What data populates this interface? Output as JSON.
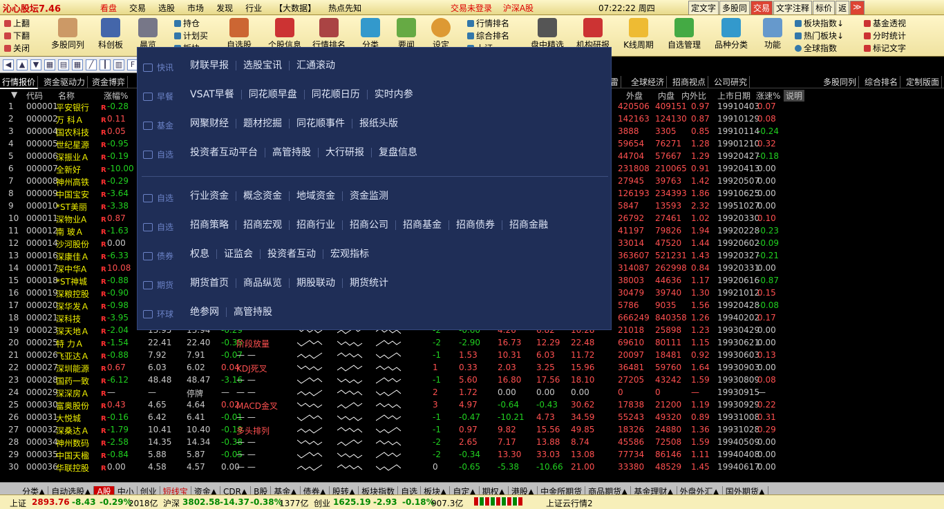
{
  "title": "沁心股坛7.46",
  "menu": [
    "看盘",
    "交易",
    "选股",
    "市场",
    "发现",
    "行业",
    "【大数据】",
    "热点先知"
  ],
  "status_login": "交易未登录",
  "status_market": "沪深A股",
  "clock": "07:22:22 周四",
  "title_buttons": [
    "定文字",
    "多股同",
    "交易",
    "文字注释",
    "标价",
    "返",
    "≫"
  ],
  "toolbar": {
    "page_nav": [
      "上翻",
      "下翻",
      "关闭"
    ],
    "big_icons": [
      "多股同列",
      "科创板",
      "晨览",
      "",
      "自选股",
      "个股信息",
      "行情排名",
      "分类",
      "要闻",
      "设定",
      "",
      "盘中精选",
      "机构研报",
      "K线周期",
      "自选管理",
      "品种分类",
      "功能"
    ],
    "smalls1": [
      "持仓",
      "计划买",
      "板块"
    ],
    "smalls2": [
      "行情排名",
      "综合排名",
      "上证"
    ],
    "smalls3": [
      "板块指数↓",
      "热门板块↓",
      "全球指数"
    ],
    "smalls4": [
      "基金透视",
      "分时统计",
      "标记文字"
    ]
  },
  "tabs_left": [
    "行情报价",
    "资金驱动力",
    "资金博弈"
  ],
  "tabs_mid": [
    "雷",
    "全球经济",
    "招商视点",
    "公司研究"
  ],
  "tabs_right": [
    "多股同列",
    "综合排名",
    "定制版面"
  ],
  "columns": {
    "code": "代码",
    "name": "名称",
    "change": "涨幅%",
    "outside": "外盘",
    "inside": "内盘",
    "ratio": "内外比",
    "listing": "上市日期",
    "speed": "涨速%",
    "note": "说明"
  },
  "rows": [
    {
      "no": "1",
      "code": "000001",
      "name": "平安银行",
      "chg": "-0.28",
      "out": "420506",
      "in": "409151",
      "ratio": "0.97",
      "date": "19910403",
      "spd": "0.07"
    },
    {
      "no": "2",
      "code": "000002",
      "name": "万  科Ａ",
      "chg": "0.11",
      "out": "142163",
      "in": "124130",
      "ratio": "0.87",
      "date": "19910129",
      "spd": "0.08"
    },
    {
      "no": "3",
      "code": "000004",
      "name": "国农科技",
      "chg": "0.05",
      "out": "3888",
      "in": "3305",
      "ratio": "0.85",
      "date": "19910114",
      "spd": "-0.24"
    },
    {
      "no": "4",
      "code": "000005",
      "name": "世纪星源",
      "chg": "-0.95",
      "out": "59654",
      "in": "76271",
      "ratio": "1.28",
      "date": "19901210",
      "spd": "0.32"
    },
    {
      "no": "5",
      "code": "000006",
      "name": "深振业Ａ",
      "chg": "-0.19",
      "out": "44704",
      "in": "57667",
      "ratio": "1.29",
      "date": "19920427",
      "spd": "-0.18"
    },
    {
      "no": "6",
      "code": "000007",
      "name": "全新好",
      "chg": "-10.00",
      "out": "231808",
      "in": "210065",
      "ratio": "0.91",
      "date": "19920413",
      "spd": "0.00"
    },
    {
      "no": "7",
      "code": "000008",
      "name": "神州高铁",
      "chg": "-0.29",
      "out": "27945",
      "in": "39763",
      "ratio": "1.42",
      "date": "19920507",
      "spd": "0.00"
    },
    {
      "no": "8",
      "code": "000009",
      "name": "中国宝安",
      "chg": "-3.64",
      "out": "126193",
      "in": "234393",
      "ratio": "1.86",
      "date": "19910625",
      "spd": "0.00"
    },
    {
      "no": "9",
      "code": "000010",
      "name": "*ST美丽",
      "chg": "-3.38",
      "out": "5847",
      "in": "13593",
      "ratio": "2.32",
      "date": "19951027",
      "spd": "0.00"
    },
    {
      "no": "10",
      "code": "000011",
      "name": "深物业A",
      "chg": "0.87",
      "out": "26792",
      "in": "27461",
      "ratio": "1.02",
      "date": "19920330",
      "spd": "0.10"
    },
    {
      "no": "11",
      "code": "000012",
      "name": "南  玻Ａ",
      "chg": "-1.63",
      "out": "41197",
      "in": "79826",
      "ratio": "1.94",
      "date": "19920228",
      "spd": "-0.23"
    },
    {
      "no": "12",
      "code": "000014",
      "name": "沙河股份",
      "chg": "0.00",
      "out": "33014",
      "in": "47520",
      "ratio": "1.44",
      "date": "19920602",
      "spd": "-0.09"
    },
    {
      "no": "13",
      "code": "000016",
      "name": "深康佳Ａ",
      "chg": "-6.33",
      "out": "363607",
      "in": "521231",
      "ratio": "1.43",
      "date": "19920327",
      "spd": "-0.21"
    },
    {
      "no": "14",
      "code": "000017",
      "name": "深中华A",
      "chg": "10.08",
      "out": "314087",
      "in": "262998",
      "ratio": "0.84",
      "date": "19920331",
      "spd": "0.00"
    },
    {
      "no": "15",
      "code": "000018",
      "name": "*ST神城",
      "chg": "-0.88",
      "out": "38003",
      "in": "44636",
      "ratio": "1.17",
      "date": "19920616",
      "spd": "-0.87"
    },
    {
      "no": "16",
      "code": "000019",
      "name": "深粮控股",
      "chg": "-0.90",
      "out": "30479",
      "in": "39740",
      "ratio": "1.30",
      "date": "19921012",
      "spd": "0.15"
    },
    {
      "no": "17",
      "code": "000020",
      "name": "深华发Ａ",
      "chg": "-0.98",
      "out": "5786",
      "in": "9035",
      "ratio": "1.56",
      "date": "19920428",
      "spd": "-0.08"
    },
    {
      "no": "18",
      "code": "000021",
      "name": "深科技",
      "chg": "-3.95",
      "out": "666249",
      "in": "840358",
      "ratio": "1.26",
      "date": "19940202",
      "spd": "0.17"
    },
    {
      "no": "19",
      "code": "000023",
      "name": "深天地Ａ",
      "chg": "-2.04",
      "p1": "13.95",
      "p2": "13.94",
      "p3": "-0.29",
      "desc": "",
      "c1": "-2",
      "c2": "-0.60",
      "c3": "4.26",
      "c4": "6.82",
      "c5": "10.28",
      "out": "21018",
      "in": "25898",
      "ratio": "1.23",
      "date": "19930429",
      "spd": "0.00"
    },
    {
      "no": "20",
      "code": "000025",
      "name": "特  力Ａ",
      "chg": "-1.54",
      "p1": "22.41",
      "p2": "22.40",
      "p3": "-0.35",
      "desc": "阶段放量",
      "c1": "-2",
      "c2": "-2.90",
      "c3": "16.73",
      "c4": "12.29",
      "c5": "22.48",
      "out": "69610",
      "in": "80111",
      "ratio": "1.15",
      "date": "19930621",
      "spd": "0.00"
    },
    {
      "no": "21",
      "code": "000026",
      "name": "飞亚达Ａ",
      "chg": "-0.88",
      "p1": "7.92",
      "p2": "7.91",
      "p3": "-0.07",
      "desc": "— —",
      "c1": "-1",
      "c2": "1.53",
      "c3": "10.31",
      "c4": "6.03",
      "c5": "11.72",
      "out": "20097",
      "in": "18481",
      "ratio": "0.92",
      "date": "19930603",
      "spd": "0.13"
    },
    {
      "no": "22",
      "code": "000027",
      "name": "深圳能源",
      "chg": "0.67",
      "p1": "6.03",
      "p2": "6.02",
      "p3": "0.04",
      "desc": "KDJ死叉",
      "c1": "1",
      "c2": "0.33",
      "c3": "2.03",
      "c4": "3.25",
      "c5": "15.96",
      "out": "36481",
      "in": "59760",
      "ratio": "1.64",
      "date": "19930903",
      "spd": "0.00"
    },
    {
      "no": "23",
      "code": "000028",
      "name": "国药一致",
      "chg": "-6.12",
      "p1": "48.48",
      "p2": "48.47",
      "p3": "-3.16",
      "desc": "— —",
      "c1": "-1",
      "c2": "5.60",
      "c3": "16.80",
      "c4": "17.56",
      "c5": "18.10",
      "out": "27205",
      "in": "43242",
      "ratio": "1.59",
      "date": "19930809",
      "spd": "0.08"
    },
    {
      "no": "24",
      "code": "000029",
      "name": "深深房Ａ",
      "chg": "—",
      "p1": "—",
      "p2": "停牌",
      "p3": "—",
      "desc": "— —",
      "c1": "2",
      "c2": "1.72",
      "c3": "0.00",
      "c4": "0.00",
      "c5": "0.00",
      "out": "0",
      "in": "0",
      "ratio": "—",
      "date": "19930915",
      "spd": "—"
    },
    {
      "no": "25",
      "code": "000030",
      "name": "富奥股份",
      "chg": "0.43",
      "p1": "4.65",
      "p2": "4.64",
      "p3": "0.02",
      "desc": "MACD金叉",
      "c1": "3",
      "c2": "4.97",
      "c3": "-0.64",
      "c4": "-0.43",
      "c5": "30.62",
      "out": "17838",
      "in": "21200",
      "ratio": "1.19",
      "date": "19930929",
      "spd": "0.22"
    },
    {
      "no": "26",
      "code": "000031",
      "name": "大悦城",
      "chg": "-0.16",
      "p1": "6.42",
      "p2": "6.41",
      "p3": "-0.01",
      "desc": "— —",
      "c1": "-1",
      "c2": "-0.47",
      "c3": "-10.21",
      "c4": "4.73",
      "c5": "34.59",
      "out": "55243",
      "in": "49320",
      "ratio": "0.89",
      "date": "19931008",
      "spd": "0.31"
    },
    {
      "no": "27",
      "code": "000032",
      "name": "深桑达Ａ",
      "chg": "-1.79",
      "p1": "10.41",
      "p2": "10.40",
      "p3": "-0.19",
      "desc": "多头排列",
      "c1": "-1",
      "c2": "0.97",
      "c3": "9.82",
      "c4": "15.56",
      "c5": "49.85",
      "out": "18326",
      "in": "24880",
      "ratio": "1.36",
      "date": "19931028",
      "spd": "0.29"
    },
    {
      "no": "28",
      "code": "000034",
      "name": "神州数码",
      "chg": "-2.58",
      "p1": "14.35",
      "p2": "14.34",
      "p3": "-0.38",
      "desc": "— —",
      "c1": "-2",
      "c2": "2.65",
      "c3": "7.17",
      "c4": "13.88",
      "c5": "8.74",
      "out": "45586",
      "in": "72508",
      "ratio": "1.59",
      "date": "19940509",
      "spd": "0.00"
    },
    {
      "no": "29",
      "code": "000035",
      "name": "中国天楹",
      "chg": "-0.84",
      "p1": "5.88",
      "p2": "5.87",
      "p3": "-0.05",
      "desc": "— —",
      "c1": "-2",
      "c2": "-0.34",
      "c3": "13.30",
      "c4": "33.03",
      "c5": "13.08",
      "out": "77734",
      "in": "86146",
      "ratio": "1.11",
      "date": "19940408",
      "spd": "0.00"
    },
    {
      "no": "30",
      "code": "000036",
      "name": "华联控股",
      "chg": "0.00",
      "p1": "4.58",
      "p2": "4.57",
      "p3": "0.00",
      "desc": "— —",
      "c1": "0",
      "c2": "-0.65",
      "c3": "-5.38",
      "c4": "-10.66",
      "c5": "21.00",
      "out": "33380",
      "in": "48529",
      "ratio": "1.45",
      "date": "19940617",
      "spd": "0.00"
    }
  ],
  "overlay": [
    {
      "cat": "快讯",
      "links": [
        "财联早报",
        "选股宝讯",
        "汇通滚动"
      ]
    },
    {
      "cat": "早餐",
      "links": [
        "VSAT早餐",
        "同花顺早盘",
        "同花顺日历",
        "实时内参"
      ]
    },
    {
      "cat": "基金",
      "links": [
        "网聚财经",
        "题材挖掘",
        "同花顺事件",
        "报纸头版"
      ]
    },
    {
      "cat": "自选",
      "links": [
        "投资者互动平台",
        "高管持股",
        "大行研报",
        "复盘信息"
      ]
    },
    {
      "cat": "自选",
      "links": [
        "行业资金",
        "概念资金",
        "地域资金",
        "资金监测"
      ]
    },
    {
      "cat": "自选",
      "links": [
        "招商策略",
        "招商宏观",
        "招商行业",
        "招商公司",
        "招商基金",
        "招商债券",
        "招商金融"
      ]
    },
    {
      "cat": "债券",
      "links": [
        "权息",
        "证监会",
        "投资者互动",
        "宏观指标"
      ]
    },
    {
      "cat": "期货",
      "links": [
        "期货首页",
        "商品纵览",
        "期股联动",
        "期货统计"
      ]
    },
    {
      "cat": "环球",
      "links": [
        "绝参网",
        "高管持股"
      ]
    }
  ],
  "bottom_tabs": [
    "分类▲",
    "自动选股▲",
    "A股",
    "中小",
    "创业",
    "短线宝",
    "资金▲",
    "CDR▲",
    "B股",
    "基金▲",
    "债券▲",
    "股转▲",
    "板块指数",
    "自选",
    "板块▲",
    "自定▲",
    "期权▲",
    "港股▲",
    "中金所期货",
    "商品期货▲",
    "基金理财▲",
    "外盘外汇▲",
    "国外期货▲"
  ],
  "statusbar": {
    "sh_label": "上证",
    "sh_val": "2893.76",
    "sh_chg": "-8.43",
    "sh_pct": "-0.29%",
    "sh_amt": "2018亿",
    "sz_label": "沪深",
    "sz_val": "3802.58",
    "sz_chg": "-14.37",
    "sz_pct": "-0.38%",
    "sz_amt": "1377亿",
    "cy_label": "创业",
    "cy_val": "1625.19",
    "cy_chg": "-2.93",
    "cy_pct": "-0.18%",
    "cy_amt": "907.3亿",
    "cloud": "上证云行情2"
  }
}
